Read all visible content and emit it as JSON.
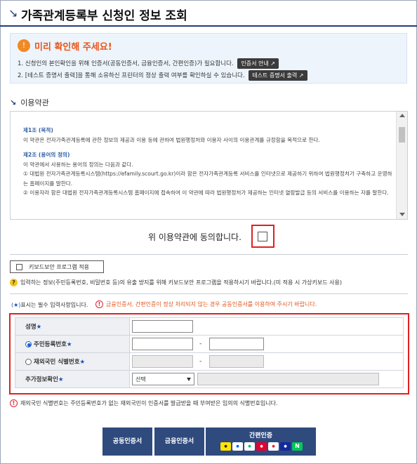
{
  "header": {
    "title": "가족관계등록부 신청인 정보 조회"
  },
  "notice": {
    "title": "미리 확인해 주세요!",
    "line1": "1. 신청인의 본인확인을 위해 인증서(공동인증서, 금융인증서, 간편인증)가 필요합니다.",
    "cert_guide_button": "인증서 안내",
    "line2": "2. [테스트 증명서 출력]을 통해 소유하신 프린터의 정상 출력 여부를 확인하실 수 있습니다.",
    "test_print_button": "테스트 증명서 출력"
  },
  "terms": {
    "section_title": "이용약관",
    "article1_title": "제1조 (목적)",
    "article1_text": "이 약관은 전자가족관계등록에 관한 정보의 제공과 이용 등에 관하여 법원행정처와 이용자 사이의 이용관계를 규정함을 목적으로 한다.",
    "article2_title": "제2조 (용어의 정의)",
    "article2_intro": "이 약관에서 사용하는 용어의 정의는 다음과 같다.",
    "article2_item1": "① 대법원 전자가족관계등록시스템(https://efamily.scourt.go.kr)이라 함은 전자가족관계등록 서비스를 인터넷으로 제공하기 위하여 법원행정처가 구축하고 운영하는 홈페이지를 말한다.",
    "article2_item2": "② 이용자라 함은 대법원 전자가족관계등록시스템 홈페이지에 접속하여 이 약관에 따라 법원행정처가 제공하는 인터넷 열람발급 등의 서비스를 이용하는 자를 말한다."
  },
  "agree": {
    "label": "위 이용약관에 동의합니다.",
    "checked": false
  },
  "keyboard": {
    "button_label": "키보드보안 프로그램 적용",
    "note": "입력하는 정보(주민등록번호, 비밀번호 등)의 유출 방지를 위해 키보드보안 프로그램을 적용하시기 바랍니다.(미 적용 시 가상키보드 사용)"
  },
  "form": {
    "required_note_star": "(★)",
    "required_note": "표시는 필수 입력사항입니다.",
    "warning": "금융인증서, 간편인증이 정상 처리되지 않는 경우 공동인증서를 이용하여 주시기 바랍니다.",
    "name_label": "성명",
    "rrn_label": "주민등록번호",
    "foreigner_label": "재외국민 식별번호",
    "extra_label": "추가정보확인",
    "star": "★",
    "dash": "-",
    "select_value": "선택",
    "selected_id_type": "rrn",
    "footnote": "재외국민 식별번호는 주민등록번호가 없는 재외국민이 인증서를 발급받을 때 부여받은 임의의 식별번호입니다."
  },
  "buttons": {
    "joint_cert": "공동인증서",
    "financial_cert": "금융인증서",
    "simple_auth": "간편인증",
    "logos": [
      "kakao",
      "toss",
      "naver-pay",
      "PASS",
      "Payco",
      "samsung",
      "N"
    ]
  },
  "colors": {
    "accent": "#1f3d7a",
    "highlight_box": "#e02020",
    "warning_text": "#e0551a",
    "button_bg": "#2f4a7d"
  }
}
